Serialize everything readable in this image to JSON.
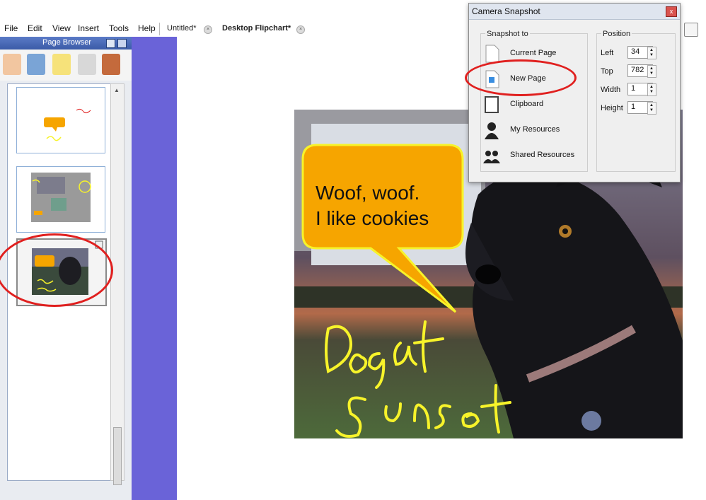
{
  "menubar": {
    "items": [
      "File",
      "Edit",
      "View",
      "Insert",
      "Tools",
      "Help"
    ],
    "tabs": [
      {
        "label": "Untitled*",
        "active": false
      },
      {
        "label": "Desktop Flipchart*",
        "active": true
      }
    ]
  },
  "page_browser": {
    "title": "Page Browser",
    "tool_icons": [
      "gallery-icon",
      "resource-icon",
      "notes-icon",
      "property-icon",
      "object-icon"
    ],
    "pages": [
      {
        "id": 1,
        "selected": false
      },
      {
        "id": 2,
        "selected": false
      },
      {
        "id": 3,
        "selected": true
      }
    ]
  },
  "canvas": {
    "bubble_line1": "Woof, woof.",
    "bubble_line2": "I like cookies",
    "handwriting": "Dog at sunset"
  },
  "dialog": {
    "title": "Camera Snapshot",
    "close": "x",
    "snapshot_to_label": "Snapshot to",
    "items": [
      {
        "label": "Current Page",
        "icon": "blank-page-icon"
      },
      {
        "label": "New Page",
        "icon": "new-page-icon"
      },
      {
        "label": "Clipboard",
        "icon": "clipboard-icon"
      },
      {
        "label": "My Resources",
        "icon": "person-icon"
      },
      {
        "label": "Shared Resources",
        "icon": "group-icon"
      }
    ],
    "position_label": "Position",
    "position": {
      "left_label": "Left",
      "left_value": "34",
      "top_label": "Top",
      "top_value": "782",
      "width_label": "Width",
      "width_value": "1",
      "height_label": "Height",
      "height_value": "1"
    }
  },
  "colors": {
    "annotation_red": "#e0201f",
    "bubble_orange": "#f6a500",
    "handwriting_yellow": "#f7f32a",
    "side_bar_blue": "#6a63d8"
  }
}
